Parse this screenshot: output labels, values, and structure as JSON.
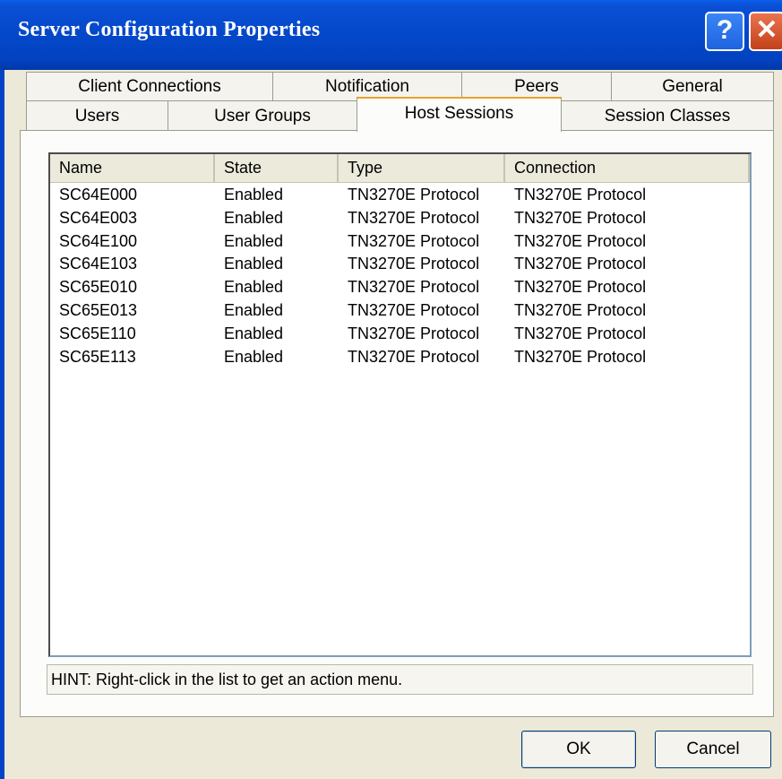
{
  "window": {
    "title": "Server Configuration Properties",
    "help_label": "?",
    "close_label": "✕"
  },
  "tabs_back": [
    {
      "label": "Client Connections"
    },
    {
      "label": "Notification"
    },
    {
      "label": "Peers"
    },
    {
      "label": "General"
    }
  ],
  "tabs_front": [
    {
      "label": "Users"
    },
    {
      "label": "User Groups"
    },
    {
      "label": "Host Sessions",
      "active": true
    },
    {
      "label": "Session Classes"
    }
  ],
  "list": {
    "columns": [
      "Name",
      "State",
      "Type",
      "Connection"
    ],
    "rows": [
      [
        "SC64E000",
        "Enabled",
        "TN3270E Protocol",
        "TN3270E Protocol"
      ],
      [
        "SC64E003",
        "Enabled",
        "TN3270E Protocol",
        "TN3270E Protocol"
      ],
      [
        "SC64E100",
        "Enabled",
        "TN3270E Protocol",
        "TN3270E Protocol"
      ],
      [
        "SC64E103",
        "Enabled",
        "TN3270E Protocol",
        "TN3270E Protocol"
      ],
      [
        "SC65E010",
        "Enabled",
        "TN3270E Protocol",
        "TN3270E Protocol"
      ],
      [
        "SC65E013",
        "Enabled",
        "TN3270E Protocol",
        "TN3270E Protocol"
      ],
      [
        "SC65E110",
        "Enabled",
        "TN3270E Protocol",
        "TN3270E Protocol"
      ],
      [
        "SC65E113",
        "Enabled",
        "TN3270E Protocol",
        "TN3270E Protocol"
      ]
    ]
  },
  "hint": "HINT: Right-click in the list to get an action menu.",
  "buttons": {
    "ok": "OK",
    "cancel": "Cancel"
  }
}
